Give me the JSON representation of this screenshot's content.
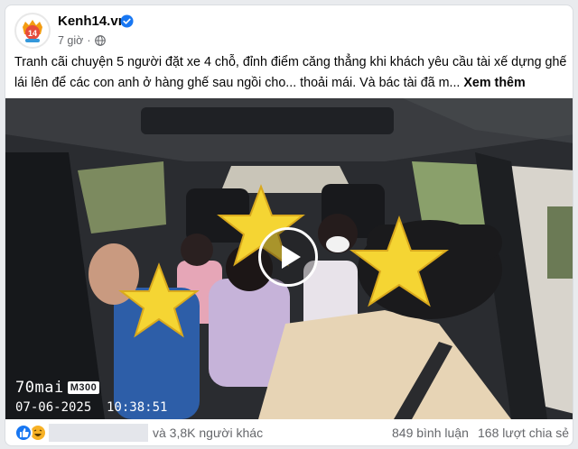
{
  "post": {
    "page_name": "Kenh14.vn",
    "time_ago": "7 giờ",
    "privacy_icon": "globe-icon",
    "verified_icon": "verified-badge-icon",
    "caption": "Tranh cãi chuyện 5 người đặt xe 4 chỗ, đỉnh điểm căng thẳng khi khách yêu cầu tài xế dựng ghế lái lên để các con anh ở hàng ghế sau ngồi cho... thoải mái. Và bác tài đã m...",
    "see_more": "Xem thêm"
  },
  "video": {
    "cam_brand": "70mai",
    "cam_model": "M300",
    "date": "07-06-2025",
    "time": "10:38:51",
    "play_icon": "play-icon"
  },
  "footer": {
    "reaction_icons": [
      "like-icon",
      "haha-icon"
    ],
    "others_text": "và 3,8K người khác",
    "comments": "849 bình luận",
    "shares": "168 lượt chia sẻ"
  },
  "colors": {
    "brand_blue": "#1877f2",
    "text_secondary": "#65676b",
    "sticker_yellow": "#f5d533"
  }
}
